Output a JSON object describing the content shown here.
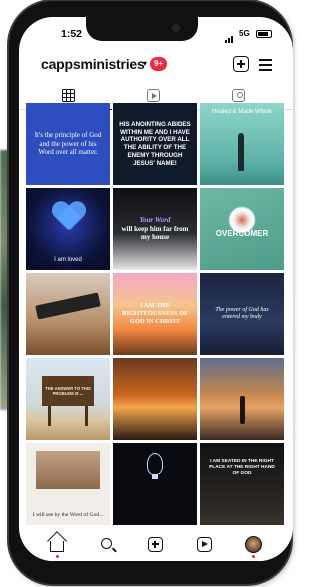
{
  "status_bar": {
    "time": "1:52",
    "network": "5G"
  },
  "profile": {
    "username": "cappsministries",
    "notification_count": "9+"
  },
  "tabs": [
    {
      "name": "grid",
      "icon": "grid-icon",
      "active": true
    },
    {
      "name": "reels",
      "icon": "reels-icon",
      "active": false
    },
    {
      "name": "tagged",
      "icon": "tagged-icon",
      "active": false
    }
  ],
  "posts": [
    {
      "text": "It's the principle of God and the power of his Word over all matter."
    },
    {
      "text": "His anointing abides within me and I have authority over all the ability of the enemy through Jesus' Name!"
    },
    {
      "text": "Healed & Made Whole"
    },
    {
      "text": "I am loved"
    },
    {
      "text_a": "Your Word",
      "text_b": "will keep him far from my house"
    },
    {
      "text": "Overcomer"
    },
    {
      "text": ""
    },
    {
      "text": "I am the righteousness of God in Christ"
    },
    {
      "text": "The power of God has entered my body"
    },
    {
      "text": "The answer to this problem is ..."
    },
    {
      "text": ""
    },
    {
      "text": ""
    },
    {
      "text": "I will see by the Word of God..."
    },
    {
      "text": ""
    },
    {
      "text": "I am seated in the right place at the right hand of God"
    }
  ],
  "nav": [
    {
      "name": "home",
      "icon": "home-icon"
    },
    {
      "name": "search",
      "icon": "search-icon"
    },
    {
      "name": "create",
      "icon": "create-icon"
    },
    {
      "name": "reels",
      "icon": "reels-icon"
    },
    {
      "name": "profile",
      "icon": "profile-icon"
    }
  ],
  "colors": {
    "badge": "#ed2a3a",
    "nav_dot": "#ed2a3a"
  }
}
